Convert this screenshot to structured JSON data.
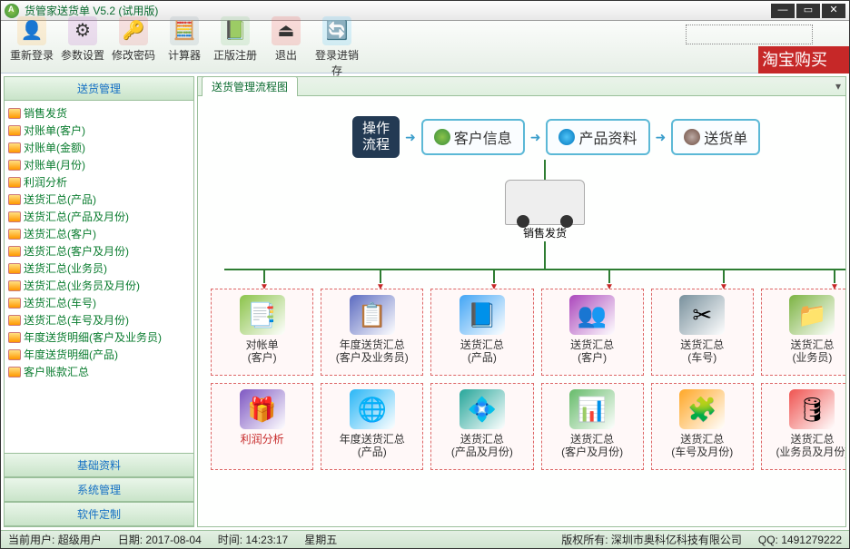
{
  "title": "货管家送货单 V5.2 (试用版)",
  "toolbar": [
    {
      "label": "重新登录",
      "icon": "👤",
      "bg": "#ffb74d"
    },
    {
      "label": "参数设置",
      "icon": "⚙",
      "bg": "#ba68c8"
    },
    {
      "label": "修改密码",
      "icon": "🔑",
      "bg": "#e57373"
    },
    {
      "label": "计算器",
      "icon": "🧮",
      "bg": "#90a4ae"
    },
    {
      "label": "正版注册",
      "icon": "📗",
      "bg": "#81c784"
    },
    {
      "label": "退出",
      "icon": "⏏",
      "bg": "#ef5350"
    },
    {
      "label": "登录进销存",
      "icon": "🔄",
      "bg": "#4fc3f7"
    }
  ],
  "ribbon_text": "",
  "buy_label": "淘宝购买",
  "nav_groups": {
    "active": "送货管理",
    "others": [
      "基础资料",
      "系统管理",
      "软件定制"
    ]
  },
  "tree": [
    "销售发货",
    "对账单(客户)",
    "对账单(金额)",
    "对账单(月份)",
    "利润分析",
    "送货汇总(产品)",
    "送货汇总(产品及月份)",
    "送货汇总(客户)",
    "送货汇总(客户及月份)",
    "送货汇总(业务员)",
    "送货汇总(业务员及月份)",
    "送货汇总(车号)",
    "送货汇总(车号及月份)",
    "年度送货明细(客户及业务员)",
    "年度送货明细(产品)",
    "客户账款汇总"
  ],
  "tab": "送货管理流程图",
  "flow": {
    "start": "操作\n流程",
    "steps": [
      "客户信息",
      "产品资料",
      "送货单"
    ],
    "center": "销售发货"
  },
  "cards_row1": [
    {
      "t1": "对帐单",
      "t2": "(客户)",
      "icon": "📑",
      "c": "#8bc34a"
    },
    {
      "t1": "年度送货汇总",
      "t2": "(客户及业务员)",
      "icon": "📋",
      "c": "#5c6bc0"
    },
    {
      "t1": "送货汇总",
      "t2": "(产品)",
      "icon": "📘",
      "c": "#42a5f5"
    },
    {
      "t1": "送货汇总",
      "t2": "(客户)",
      "icon": "👥",
      "c": "#ab47bc"
    },
    {
      "t1": "送货汇总",
      "t2": "(车号)",
      "icon": "✂",
      "c": "#78909c"
    },
    {
      "t1": "送货汇总",
      "t2": "(业务员)",
      "icon": "📁",
      "c": "#7cb342"
    }
  ],
  "cards_row2": [
    {
      "t1": "利润分析",
      "t2": "",
      "icon": "🎁",
      "c": "#7e57c2",
      "red": true
    },
    {
      "t1": "年度送货汇总",
      "t2": "(产品)",
      "icon": "🌐",
      "c": "#29b6f6"
    },
    {
      "t1": "送货汇总",
      "t2": "(产品及月份)",
      "icon": "💠",
      "c": "#26a69a"
    },
    {
      "t1": "送货汇总",
      "t2": "(客户及月份)",
      "icon": "📊",
      "c": "#66bb6a"
    },
    {
      "t1": "送货汇总",
      "t2": "(车号及月份)",
      "icon": "🧩",
      "c": "#ffa726"
    },
    {
      "t1": "送货汇总",
      "t2": "(业务员及月份)",
      "icon": "🛢",
      "c": "#ef5350"
    }
  ],
  "status": {
    "user_lbl": "当前用户:",
    "user": "超级用户",
    "date_lbl": "日期:",
    "date": "2017-08-04",
    "time_lbl": "时间:",
    "time": "14:23:17",
    "weekday": "星期五",
    "copyright": "版权所有: 深圳市奥科亿科技有限公司",
    "qq_lbl": "QQ:",
    "qq": "1491279222"
  }
}
